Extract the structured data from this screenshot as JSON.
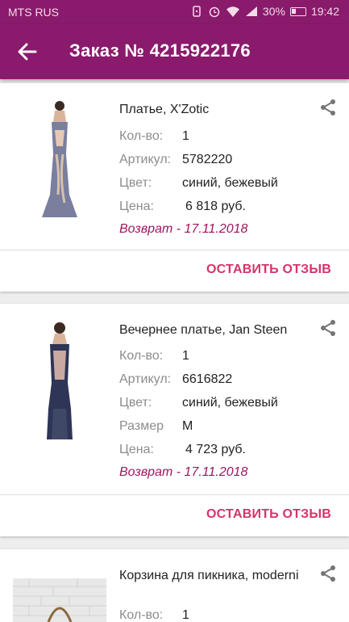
{
  "status": {
    "carrier": "MTS RUS",
    "battery": "30%",
    "time": "19:42"
  },
  "header": {
    "title": "Заказ № 4215922176",
    "back_icon": "arrow-left-icon"
  },
  "colors": {
    "primary": "#8a1a6c",
    "accent": "#d6336c",
    "return": "#a0155f"
  },
  "items": [
    {
      "name": "Платье, X'Zotic",
      "qty_label": "Кол-во:",
      "qty": "1",
      "sku_label": "Артикул:",
      "sku": "5782220",
      "color_label": "Цвет:",
      "color": "синий, бежевый",
      "price_label": "Цена:",
      "price": "6 818 руб.",
      "return": "Возврат - 17.11.2018",
      "review": "ОСТАВИТЬ ОТЗЫВ"
    },
    {
      "name": "Вечернее платье, Jan Steen",
      "qty_label": "Кол-во:",
      "qty": "1",
      "sku_label": "Артикул:",
      "sku": "6616822",
      "color_label": "Цвет:",
      "color": "синий, бежевый",
      "size_label": "Размер",
      "size": "M",
      "price_label": "Цена:",
      "price": "4 723 руб.",
      "return": "Возврат - 17.11.2018",
      "review": "ОСТАВИТЬ ОТЗЫВ"
    },
    {
      "name": "Корзина для пикника, moderni",
      "qty_label": "Кол-во:",
      "qty": "1"
    }
  ]
}
